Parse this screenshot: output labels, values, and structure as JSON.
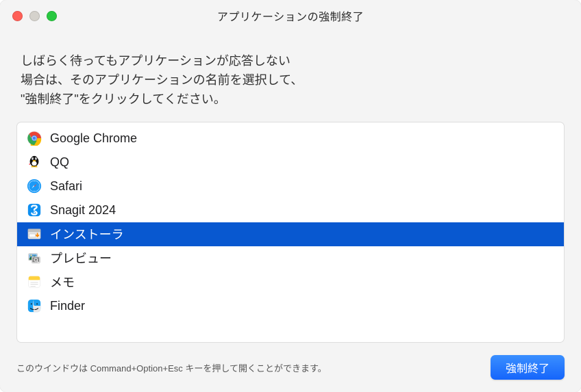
{
  "window": {
    "title": "アプリケーションの強制終了"
  },
  "instructions": {
    "line1": "しばらく待ってもアプリケーションが応答しない",
    "line2": "場合は、そのアプリケーションの名前を選択して、",
    "line3": "\"強制終了\"をクリックしてください。"
  },
  "apps": [
    {
      "name": "Google Chrome",
      "icon": "chrome",
      "selected": false
    },
    {
      "name": "QQ",
      "icon": "qq",
      "selected": false
    },
    {
      "name": "Safari",
      "icon": "safari",
      "selected": false
    },
    {
      "name": "Snagit 2024",
      "icon": "snagit",
      "selected": false
    },
    {
      "name": "インストーラ",
      "icon": "installer",
      "selected": true
    },
    {
      "name": "プレビュー",
      "icon": "preview",
      "selected": false
    },
    {
      "name": "メモ",
      "icon": "notes",
      "selected": false
    },
    {
      "name": "Finder",
      "icon": "finder",
      "selected": false
    }
  ],
  "footer": {
    "hint": "このウインドウは Command+Option+Esc キーを押して開くことができます。",
    "button": "強制終了"
  }
}
